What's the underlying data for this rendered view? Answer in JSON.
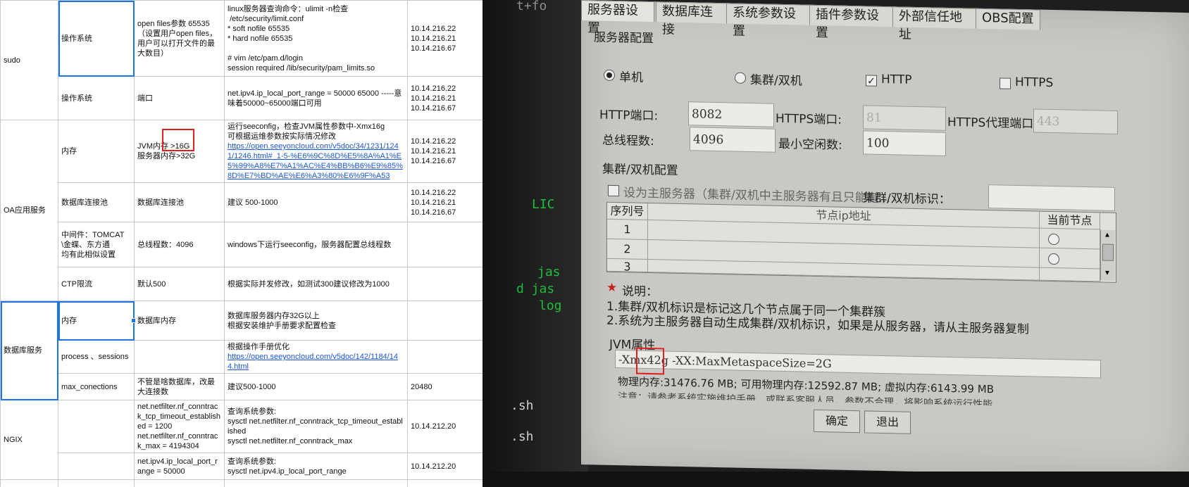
{
  "sheet": {
    "sections": {
      "sudo": "sudo",
      "oa": "OA应用服务",
      "db": "数据库服务",
      "ngix": "NGIX"
    },
    "rows": [
      {
        "item": "操作系统",
        "param": [
          "open files参数 65535",
          "（设置用户open files，用户可以打开文件的最大数目）"
        ],
        "desc": [
          "linux服务器查询命令：ulimit -n检查",
          " /etc/security/limit.conf",
          "* soft nofile 65535",
          "* hard nofile 65535",
          "",
          "# vim /etc/pam.d/login",
          "session required /lib/security/pam_limits.so"
        ],
        "ip": [
          "10.14.216.22",
          "10.14.216.21",
          "10.14.216.67"
        ]
      },
      {
        "item": "操作系统",
        "param": [
          "端口"
        ],
        "desc": [
          "net.ipv4.ip_local_port_range = 50000    65000     -----意味着50000~65000端口可用"
        ],
        "ip": [
          "10.14.216.22",
          "10.14.216.21",
          "10.14.216.67"
        ]
      },
      {
        "item": "内存",
        "param": [
          "JVM内存 >16G",
          "服务器内存>32G"
        ],
        "desc": [
          "运行seeconfig，检查JVM属性参数中-Xmx16g",
          "可根据运维参数按实际情况修改"
        ],
        "link": "https://open.seeyoncloud.com/v5doc/34/1231/1241/1246.html#_1-5-%E6%9C%8D%E5%8A%A1%E5%99%A8%E7%A1%AC%E4%BB%B6%E9%85%8D%E7%BD%AE%E6%A3%80%E6%9F%A53",
        "ip": [
          "10.14.216.22",
          "10.14.216.21",
          "10.14.216.67"
        ]
      },
      {
        "item": "数据库连接池",
        "param": [
          "数据库连接池"
        ],
        "desc": [
          "建议 500-1000"
        ],
        "ip": [
          "10.14.216.22",
          "10.14.216.21",
          "10.14.216.67"
        ]
      },
      {
        "item": "中间件：TOMCAT\\金蝶、东方通\n均有此相似设置",
        "param": [
          "总线程数：4096"
        ],
        "desc": [
          "windows下运行seeconfig，服务器配置总线程数"
        ],
        "ip": []
      },
      {
        "item": "CTP限流",
        "param": [
          "默认500"
        ],
        "desc": [
          "根据实际并发修改，如测试300建议修改为1000"
        ],
        "ip": []
      },
      {
        "item": "内存",
        "param": [
          "数据库内存"
        ],
        "desc": [
          "数据库服务器内存32G以上",
          "根据安装维护手册要求配置检查"
        ],
        "ip": []
      },
      {
        "item": "process 、sessions",
        "param": [],
        "desc": [
          "根据操作手册优化"
        ],
        "link": "https://open.seeyoncloud.com/v5doc/142/1184/144.html",
        "ip": []
      },
      {
        "item": "max_conections",
        "param": [
          "不管是啥数据库，改最大连接数"
        ],
        "desc": [
          "建议500-1000"
        ],
        "ip": [
          "20480"
        ]
      },
      {
        "item": "",
        "param": [
          "net.netfilter.nf_conntrack_tcp_timeout_established = 1200",
          "net.netfilter.nf_conntrack_max = 4194304"
        ],
        "desc": [
          "查询系统参数:",
          "sysctl net.netfilter.nf_conntrack_tcp_timeout_established",
          "sysctl net.netfilter.nf_conntrack_max"
        ],
        "ip": [
          "10.14.212.20"
        ]
      },
      {
        "item": "",
        "param": [
          "net.ipv4.ip_local_port_range = 50000"
        ],
        "desc": [
          "查询系统参数:",
          "sysctl net.ipv4.ip_local_port_range"
        ],
        "ip": [
          "10.14.212.20"
        ]
      }
    ]
  },
  "photo": {
    "terminal": {
      "line1": "LIC",
      "line2": "jas",
      "line3": "d jas",
      "line4": "log",
      "line5": ".sh",
      "line6": ".sh",
      "top": "t+fo"
    },
    "tabs": [
      "服务器设置",
      "数据库连接",
      "系统参数设置",
      "插件参数设置",
      "外部信任地址",
      "OBS配置"
    ],
    "server_config": {
      "group_title": "服务器配置",
      "mode_single": "单机",
      "mode_cluster": "集群/双机",
      "http": "HTTP",
      "https": "HTTPS",
      "http_port_label": "HTTP端口:",
      "http_port": "8082",
      "https_port_label": "HTTPS端口:",
      "https_port": "81",
      "https_proxy_label": "HTTPS代理端口:",
      "https_proxy": "443",
      "threads_label": "总线程数:",
      "threads": "4096",
      "min_idle_label": "最小空闲数:",
      "min_idle": "100"
    },
    "cluster_config": {
      "group_title": "集群/双机配置",
      "master_checkbox": "设为主服务器（集群/双机中主服务器有且只能有...",
      "cluster_id_label": "集群/双机标识：",
      "col_seq": "序列号",
      "col_ip": "节点ip地址",
      "col_current": "当前节点",
      "rows": [
        "1",
        "2",
        "3"
      ]
    },
    "notes": {
      "title": "说明：",
      "line1": "1.集群/双机标识是标记这几个节点属于同一个集群簇",
      "line2": "2.系统为主服务器自动生成集群/双机标识，如果是从服务器，请从主服务器复制"
    },
    "jvm": {
      "title": "JVM属性",
      "value": "-Xmx42g -XX:MaxMetaspaceSize=2G",
      "memory": "物理内存:31476.76 MB; 可用物理内存:12592.87 MB; 虚拟内存:6143.99 MB",
      "warning": "注意：请参考系统实施维护手册，或联系客服人员，参数不合理，将影响系统运行性能"
    },
    "buttons": {
      "ok": "确定",
      "exit": "退出"
    }
  }
}
